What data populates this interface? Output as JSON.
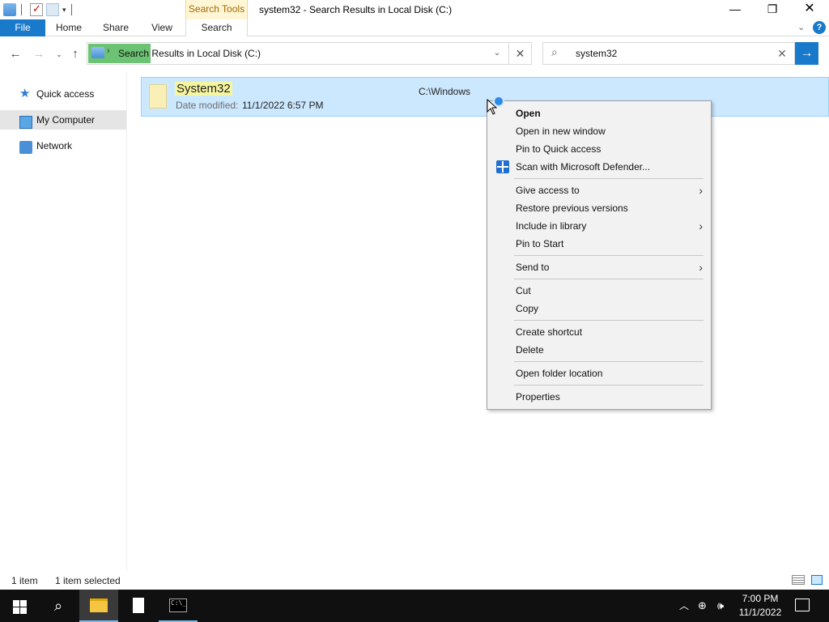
{
  "window": {
    "title": "system32 - Search Results in Local Disk (C:)",
    "contextual_tab_group": "Search Tools",
    "minimize": "—",
    "maximize": "❐",
    "close": "✕"
  },
  "ribbon": {
    "tabs": [
      "File",
      "Home",
      "Share",
      "View",
      "Search"
    ],
    "active_tab": "Search",
    "file_tab_color": "#1979ca"
  },
  "address_bar": {
    "path": "Search Results in Local Disk (C:)",
    "separator": "›"
  },
  "search": {
    "query": "system32"
  },
  "nav_pane": {
    "items": [
      {
        "label": "Quick access",
        "icon": "star-icon"
      },
      {
        "label": "My Computer",
        "icon": "computer-icon",
        "selected": true
      },
      {
        "label": "Network",
        "icon": "network-icon"
      }
    ]
  },
  "results": [
    {
      "name": "System32",
      "date_label": "Date modified:",
      "date_modified": "11/1/2022 6:57 PM",
      "path": "C:\\Windows"
    }
  ],
  "context_menu": {
    "groups": [
      [
        {
          "label": "Open",
          "bold": true
        },
        {
          "label": "Open in new window"
        },
        {
          "label": "Pin to Quick access"
        },
        {
          "label": "Scan with Microsoft Defender...",
          "icon": "defender-icon"
        }
      ],
      [
        {
          "label": "Give access to",
          "submenu": true
        },
        {
          "label": "Restore previous versions"
        },
        {
          "label": "Include in library",
          "submenu": true
        },
        {
          "label": "Pin to Start"
        }
      ],
      [
        {
          "label": "Send to",
          "submenu": true
        }
      ],
      [
        {
          "label": "Cut"
        },
        {
          "label": "Copy"
        }
      ],
      [
        {
          "label": "Create shortcut"
        },
        {
          "label": "Delete"
        }
      ],
      [
        {
          "label": "Open folder location"
        }
      ],
      [
        {
          "label": "Properties"
        }
      ]
    ]
  },
  "status_bar": {
    "item_count": "1 item",
    "selection": "1 item selected"
  },
  "taskbar": {
    "time": "7:00 PM",
    "date": "11/1/2022",
    "accent_color": "#76b9ed"
  }
}
